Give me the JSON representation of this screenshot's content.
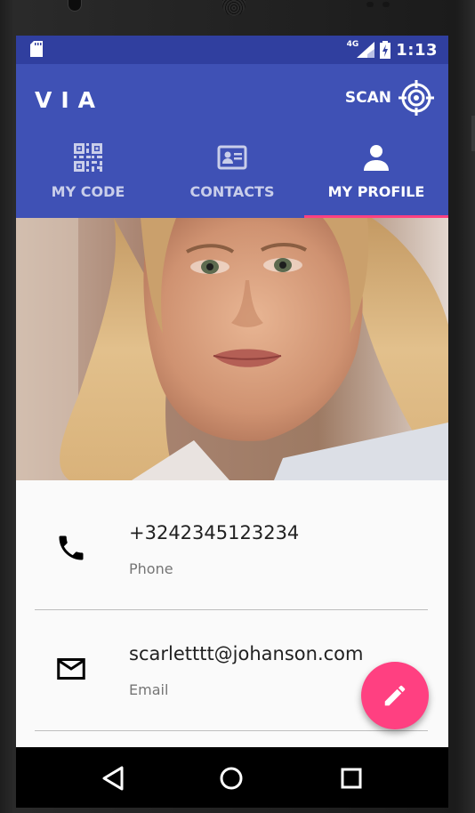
{
  "status_bar": {
    "network": "4G",
    "time": "1:13"
  },
  "app_bar": {
    "title": "VIA",
    "scan_label": "SCAN",
    "primary_color": "#3F51B5",
    "status_color": "#303F9F",
    "accent_color": "#FF4081"
  },
  "tabs": [
    {
      "label": "MY CODE",
      "icon": "qr-code-icon",
      "active": false
    },
    {
      "label": "CONTACTS",
      "icon": "contact-card-icon",
      "active": false
    },
    {
      "label": "MY PROFILE",
      "icon": "person-icon",
      "active": true
    }
  ],
  "profile": {
    "photo": "profile-photo",
    "contacts": [
      {
        "value": "+3242345123234",
        "label": "Phone",
        "icon": "phone-icon"
      },
      {
        "value": "scarletttt@johanson.com",
        "label": "Email",
        "icon": "email-icon"
      }
    ]
  },
  "fab": {
    "icon": "edit-icon"
  },
  "nav": {
    "buttons": [
      "back-icon",
      "home-icon",
      "recent-apps-icon"
    ]
  }
}
